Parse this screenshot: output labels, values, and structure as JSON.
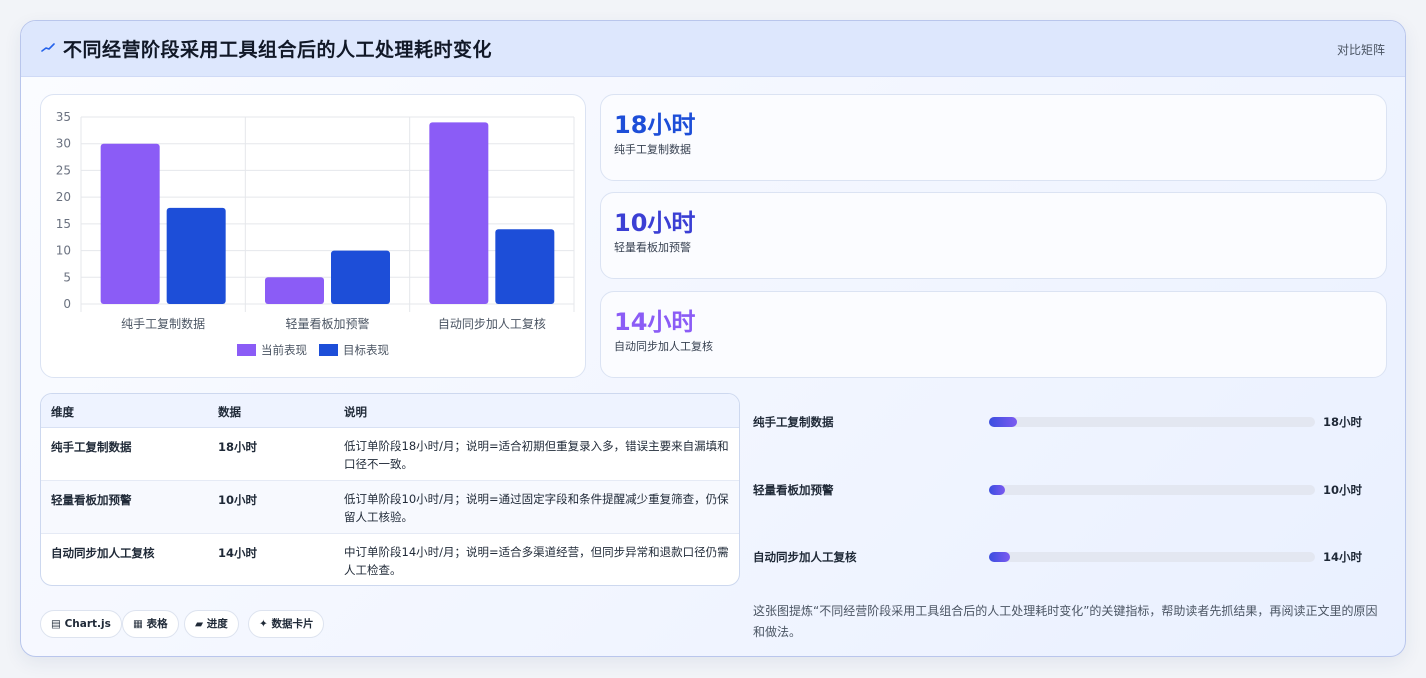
{
  "header": {
    "title": "不同经营阶段采用工具组合后的人工处理耗时变化",
    "badge": "对比矩阵"
  },
  "chart_data": {
    "type": "bar",
    "categories": [
      "纯手工复制数据",
      "轻量看板加预警",
      "自动同步加人工复核"
    ],
    "series": [
      {
        "name": "当前表现",
        "values": [
          30,
          5,
          34
        ],
        "color": "#8b5cf6"
      },
      {
        "name": "目标表现",
        "values": [
          18,
          10,
          14
        ],
        "color": "#1d4ed8"
      }
    ],
    "yticks": [
      0,
      5,
      10,
      15,
      20,
      25,
      30,
      35
    ],
    "ylim": [
      0,
      35
    ],
    "grid": true,
    "legend": "bottom"
  },
  "stats": [
    {
      "value": "18小时",
      "label": "纯手工复制数据",
      "color": "#1d4ed8"
    },
    {
      "value": "10小时",
      "label": "轻量看板加预警",
      "color": "#3b3fd4"
    },
    {
      "value": "14小时",
      "label": "自动同步加人工复核",
      "color": "#8b5cf6"
    }
  ],
  "table": {
    "headers": [
      "维度",
      "数据",
      "说明"
    ],
    "rows": [
      {
        "dim": "纯手工复制数据",
        "data": "18小时",
        "desc": "低订单阶段18小时/月；说明=适合初期但重复录入多，错误主要来自漏填和口径不一致。"
      },
      {
        "dim": "轻量看板加预警",
        "data": "10小时",
        "desc": "低订单阶段10小时/月；说明=通过固定字段和条件提醒减少重复筛查，仍保留人工核验。"
      },
      {
        "dim": "自动同步加人工复核",
        "data": "14小时",
        "desc": "中订单阶段14小时/月；说明=适合多渠道经营，但同步异常和退款口径仍需人工检查。"
      }
    ]
  },
  "progress": [
    {
      "label": "纯手工复制数据",
      "value_text": "18小时",
      "fraction": 0.085
    },
    {
      "label": "轻量看板加预警",
      "value_text": "10小时",
      "fraction": 0.05
    },
    {
      "label": "自动同步加人工复核",
      "value_text": "14小时",
      "fraction": 0.065
    }
  ],
  "chips": [
    {
      "icon": "▤",
      "label": "Chart.js"
    },
    {
      "icon": "▦",
      "label": "表格"
    },
    {
      "icon": "▰",
      "label": "进度"
    },
    {
      "icon": "✦",
      "label": "数据卡片"
    }
  ],
  "note": "这张图提炼“不同经营阶段采用工具组合后的人工处理耗时变化”的关键指标，帮助读者先抓结果，再阅读正文里的原因和做法。"
}
